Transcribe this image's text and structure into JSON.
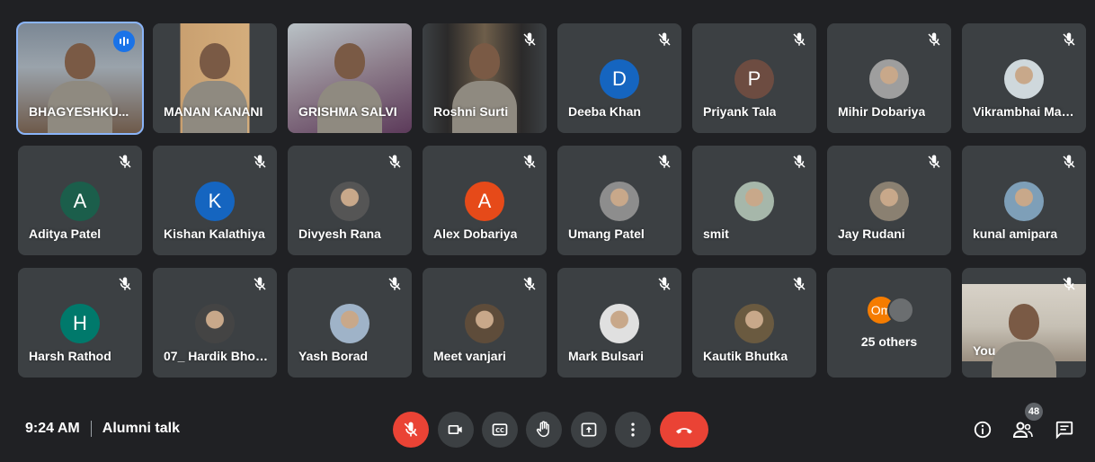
{
  "participants": [
    {
      "name": "BHAGYESHKU...",
      "type": "video",
      "speaking": true
    },
    {
      "name": "MANAN KANANI",
      "type": "video"
    },
    {
      "name": "GRISHMA SALVI",
      "type": "video"
    },
    {
      "name": "Roshni Surti",
      "type": "video",
      "muted": true
    },
    {
      "name": "Deeba Khan",
      "type": "letter",
      "letter": "D",
      "color": "#1565c0",
      "muted": true
    },
    {
      "name": "Priyank Tala",
      "type": "letter",
      "letter": "P",
      "color": "#6d4c41",
      "muted": true
    },
    {
      "name": "Mihir Dobariya",
      "type": "photo",
      "muted": true
    },
    {
      "name": "Vikrambhai Mak...",
      "type": "photo",
      "muted": true
    },
    {
      "name": "Aditya Patel",
      "type": "letter",
      "letter": "A",
      "color": "#1b5e4b",
      "muted": true
    },
    {
      "name": "Kishan Kalathiya",
      "type": "letter",
      "letter": "K",
      "color": "#1565c0",
      "muted": true
    },
    {
      "name": "Divyesh Rana",
      "type": "photo",
      "muted": true
    },
    {
      "name": "Alex Dobariya",
      "type": "letter",
      "letter": "A",
      "color": "#e64a19",
      "muted": true
    },
    {
      "name": "Umang Patel",
      "type": "photo",
      "muted": true
    },
    {
      "name": "smit",
      "type": "photo",
      "muted": true
    },
    {
      "name": "Jay Rudani",
      "type": "photo",
      "muted": true
    },
    {
      "name": "kunal amipara",
      "type": "photo",
      "muted": true
    },
    {
      "name": "Harsh Rathod",
      "type": "letter",
      "letter": "H",
      "color": "#00796b",
      "muted": true
    },
    {
      "name": "07_ Hardik Bhor...",
      "type": "photo",
      "muted": true
    },
    {
      "name": "Yash Borad",
      "type": "photo",
      "muted": true
    },
    {
      "name": "Meet vanjari",
      "type": "photo",
      "muted": true
    },
    {
      "name": "Mark Bulsari",
      "type": "photo",
      "muted": true
    },
    {
      "name": "Kautik Bhutka",
      "type": "photo",
      "muted": true
    },
    {
      "name": "25 others",
      "type": "others",
      "letter": "Om"
    },
    {
      "name": "You",
      "type": "video",
      "muted": true
    }
  ],
  "bottom": {
    "time": "9:24 AM",
    "meeting_title": "Alumni talk",
    "participant_count": "48"
  },
  "icons": [
    "mic-off-icon",
    "camera-icon",
    "captions-icon",
    "raise-hand-icon",
    "present-icon",
    "more-options-icon",
    "end-call-icon",
    "info-icon",
    "people-icon",
    "chat-icon"
  ],
  "colors": {
    "background": "#202124",
    "tile": "#3c4043",
    "red": "#ea4335",
    "speaking": "#8ab4f8"
  }
}
